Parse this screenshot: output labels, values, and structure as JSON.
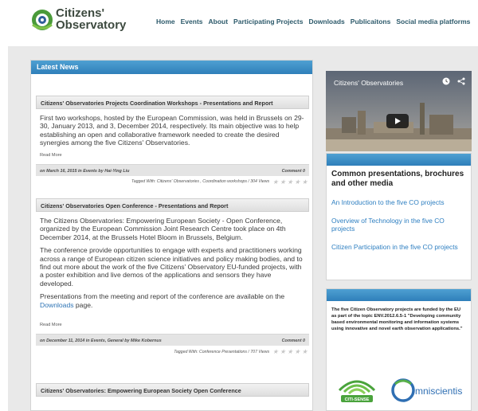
{
  "site": {
    "logo_line1": "Citizens'",
    "logo_line2": "Observatory",
    "brand_color": "#3e8f3f",
    "accent_color": "#2f7fba"
  },
  "nav": {
    "items": [
      "Home",
      "Events",
      "About",
      "Participating Projects",
      "Downloads",
      "Publicaitons",
      "Social media platforms"
    ]
  },
  "latest_news": {
    "heading": "Latest News",
    "posts": [
      {
        "title": "Citizens' Observatories Projects Coordination Workshops - Presentations and Report",
        "paragraphs": [
          "First two workshops, hosted by the European Commission, was held in Brussels on 29-30, January 2013, and 3, December 2014, respectively. Its main objective was to help establishing an open and collaborative framework needed to create the desired synergies among the five Citizens' Observatories."
        ],
        "read_more": "Read More",
        "meta": "on March 16, 2015 in Events by Hai-Ying Liu",
        "comments": "Comment 0",
        "tags": "Tagged With: Citizens' Observatories , Coordination workshops / 304 Views"
      },
      {
        "title": "Citizens' Observatories Open Conference - Presentations and Report",
        "paragraphs": [
          "The Citizens Observatories: Empowering European Society - Open Conference, organized by the European Commission Joint Research Centre took place on 4th December 2014, at the Brussels Hotel Bloom in Brussels, Belgium.",
          "The conference provide opportunities to engage with experts and practitioners working across a range of European citizen science initiatives and policy making bodies, and to find out more about the work of the five Citizens' Observatory EU-funded projects, with a poster exhibition and live demos of the applications and sensors they have developed.",
          "Presentations from the meeting and report of the conference are available on the"
        ],
        "downloads_link": "Downloads",
        "after_link": " page.",
        "read_more": "Read More",
        "meta": "on December 11, 2014 in Events, General by Mike Kobernus",
        "comments": "Comment 0",
        "tags": "Tagged With: Conference Presentations / 707 Views"
      },
      {
        "title": "Citizens' Observatories: Empowering European Society Open Conference"
      }
    ]
  },
  "sidebar": {
    "video_title": "Citizens' Observatories",
    "presentations_heading": "Common presentations, brochures and other media",
    "links": [
      "An Introduction to the five CO projects",
      "Overview of Technology in the five CO projects",
      "Citizen Participation in the five CO projects"
    ],
    "funding_text": "The five Citizen Observatory projects are funded by the EU as part of the topic ENV.2012.6.5-1 \"Developing community based environmental monitoring and information systems using innovative and novel earth observation applications.\"",
    "logo_a": "CITI-SENSE",
    "logo_b": "mniscientis"
  }
}
